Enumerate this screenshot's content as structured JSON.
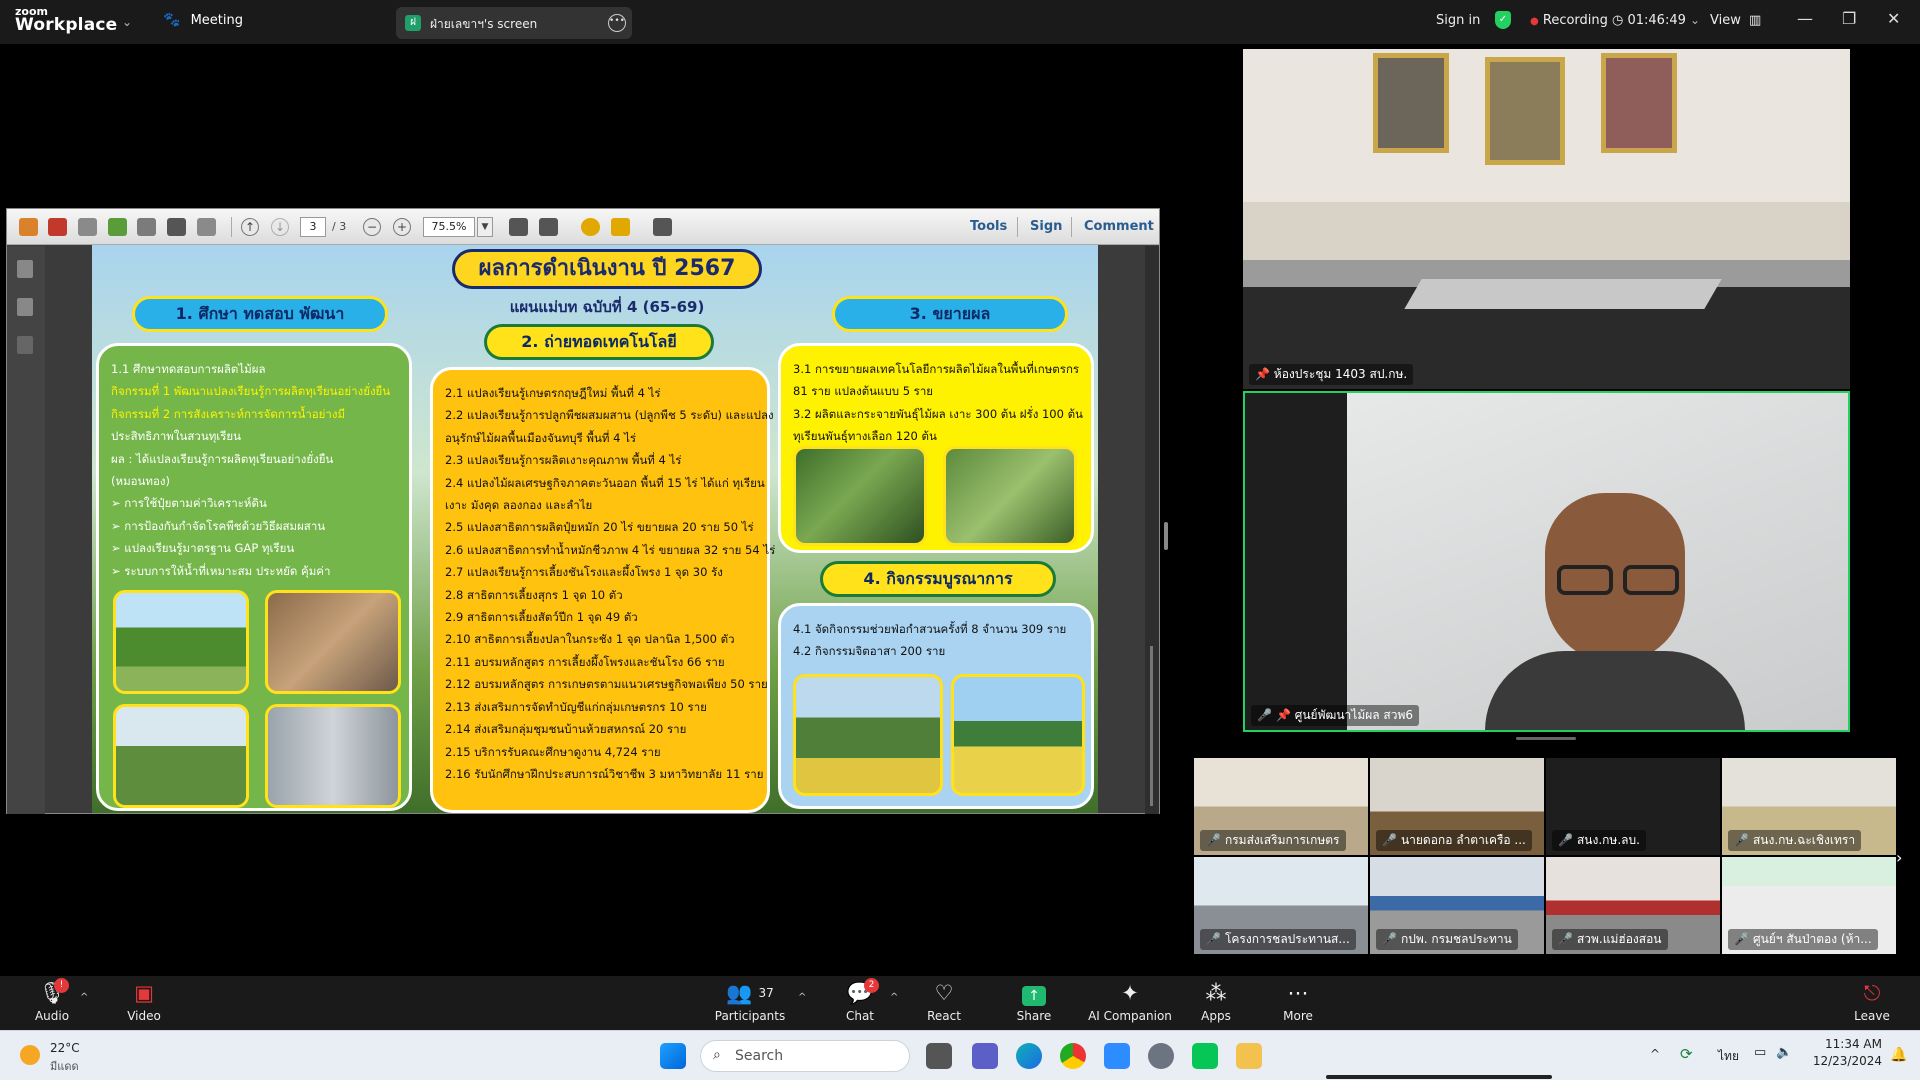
{
  "app": {
    "brand_small": "zoom",
    "brand_big": "Workplace",
    "meeting_label": "Meeting"
  },
  "share": {
    "badge": "ฝ",
    "title": "ฝ่ายเลขาฯ's screen"
  },
  "topbar": {
    "sign_in": "Sign in",
    "recording": "Recording",
    "timer": "01:46:49",
    "view": "View"
  },
  "pdf": {
    "page": "3",
    "page_total": "/ 3",
    "zoom": "75.5%",
    "tools": "Tools",
    "sign": "Sign",
    "comment": "Comment"
  },
  "slide": {
    "title": "ผลการดำเนินงาน ปี 2567",
    "subtitle": "แผนแม่บท ฉบับที่ 4 (65-69)",
    "sec1": {
      "header": "1. ศึกษา ทดสอบ พัฒนา",
      "lines": [
        {
          "t": "1.1 ศึกษาทดสอบการผลิตไม้ผล",
          "c": "w"
        },
        {
          "t": "กิจกรรมที่ 1 พัฒนาแปลงเรียนรู้การผลิตทุเรียนอย่างยั่งยืน",
          "c": "y"
        },
        {
          "t": "กิจกรรมที่ 2 การสังเคราะห์การจัดการน้ำอย่างมี",
          "c": "y"
        },
        {
          "t": "ประสิทธิภาพในสวนทุเรียน",
          "c": "w"
        },
        {
          "t": "ผล : ได้แปลงเรียนรู้การผลิตทุเรียนอย่างยั่งยืน",
          "c": "w"
        },
        {
          "t": "      (หมอนทอง)",
          "c": "w"
        },
        {
          "t": "        ➢  การใช้ปุ๋ยตามค่าวิเคราะห์ดิน",
          "c": "w"
        },
        {
          "t": "        ➢  การป้องกันกำจัดโรคพืชด้วยวิธีผสมผสาน",
          "c": "w"
        },
        {
          "t": "        ➢  แปลงเรียนรู้มาตรฐาน GAP ทุเรียน",
          "c": "w"
        },
        {
          "t": "        ➢  ระบบการให้น้ำที่เหมาะสม ประหยัด คุ้มค่า",
          "c": "w"
        }
      ]
    },
    "sec2": {
      "header": "2. ถ่ายทอดเทคโนโลยี",
      "lines": [
        "2.1 แปลงเรียนรู้เกษตรกฤษฎีใหม่ พื้นที่ 4 ไร่",
        "2.2 แปลงเรียนรู้การปลูกพืชผสมผสาน (ปลูกพืช 5 ระดับ) และแปลง",
        "      อนุรักษ์ไม้ผลพื้นเมืองจันทบุรี พื้นที่ 4 ไร่",
        "2.3 แปลงเรียนรู้การผลิตเงาะคุณภาพ พื้นที่ 4 ไร่",
        "2.4 แปลงไม้ผลเศรษฐกิจภาคตะวันออก พื้นที่ 15 ไร่ ได้แก่ ทุเรียน",
        "      เงาะ มังคุด ลองกอง และลำไย",
        "2.5 แปลงสาธิตการผลิตปุ๋ยหมัก 20 ไร่ ขยายผล 20 ราย 50 ไร่",
        "2.6 แปลงสาธิตการทำน้ำหมักชีวภาพ 4 ไร่ ขยายผล 32 ราย 54 ไร่",
        "2.7 แปลงเรียนรู้การเลี้ยงชันโรงและผึ้งโพรง 1 จุด 30 รัง",
        "2.8 สาธิตการเลี้ยงสุกร 1 จุด 10 ตัว",
        "2.9 สาธิตการเลี้ยงสัตว์ปีก 1 จุด 49 ตัว",
        "2.10 สาธิตการเลี้ยงปลาในกระชัง 1 จุด ปลานิล 1,500 ตัว",
        "2.11 อบรมหลักสูตร การเลี้ยงผึ้งโพรงและชันโรง 66 ราย",
        "2.12 อบรมหลักสูตร การเกษตรตามแนวเศรษฐกิจพอเพียง 50 ราย",
        "2.13 ส่งเสริมการจัดทำบัญชีแก่กลุ่มเกษตรกร 10 ราย",
        "2.14 ส่งเสริมกลุ่มชุมชนบ้านห้วยสหกรณ์ 20 ราย",
        "2.15 บริการรับคณะศึกษาดูงาน 4,724 ราย",
        "2.16 รับนักศึกษาฝึกประสบการณ์วิชาชีพ 3 มหาวิทยาลัย 11 ราย"
      ]
    },
    "sec3": {
      "header": "3. ขยายผล",
      "lines": [
        "3.1 การขยายผลเทคโนโลยีการผลิตไม้ผลในพื้นที่เกษตรกร",
        "      81 ราย แปลงต้นแบบ 5 ราย",
        "3.2 ผลิตและกระจายพันธุ์ไม้ผล เงาะ 300 ต้น ฝรั่ง 100 ต้น",
        "      ทุเรียนพันธุ์ทางเลือก 120 ต้น"
      ]
    },
    "sec4": {
      "header": "4. กิจกรรมบูรณาการ",
      "lines": [
        "4.1 จัดกิจกรรมช่วยฟ่อกำสวนครั้งที่ 8 จำนวน 309 ราย",
        "4.2 กิจกรรมจิตอาสา 200 ราย"
      ]
    }
  },
  "videos": {
    "main_top": {
      "name": "ห้องประชุม 1403 สป.กษ."
    },
    "main_speaker": {
      "name": "ศูนย์พัฒนาไม้ผล สวพ6"
    },
    "grid": [
      {
        "name": "กรมส่งเสริมการเกษตร"
      },
      {
        "name": "นายดอกอ ลำตาเครือ ..."
      },
      {
        "name": "สนง.กษ.ลบ."
      },
      {
        "name": "สนง.กษ.ฉะเชิงเทรา"
      },
      {
        "name": "โครงการชลประทานส..."
      },
      {
        "name": "กปพ. กรมชลประทาน"
      },
      {
        "name": "สวพ.แม่ฮ่องสอน"
      },
      {
        "name": "ศูนย์ฯ สันป่าตอง (ห้า..."
      }
    ]
  },
  "controls": {
    "audio": "Audio",
    "video": "Video",
    "participants": "Participants",
    "participants_count": "37",
    "chat": "Chat",
    "chat_badge": "2",
    "react": "React",
    "share": "Share",
    "ai": "AI Companion",
    "apps": "Apps",
    "more": "More",
    "leave": "Leave"
  },
  "taskbar": {
    "weather_temp": "22°C",
    "weather_desc": "มีแดด",
    "search_placeholder": "Search",
    "lang": "ไทย",
    "time": "11:34 AM",
    "date": "12/23/2024"
  },
  "colors": {
    "accent_green": "#23d160",
    "record_red": "#e5383b",
    "zoom_share_green": "#1fb96f"
  }
}
